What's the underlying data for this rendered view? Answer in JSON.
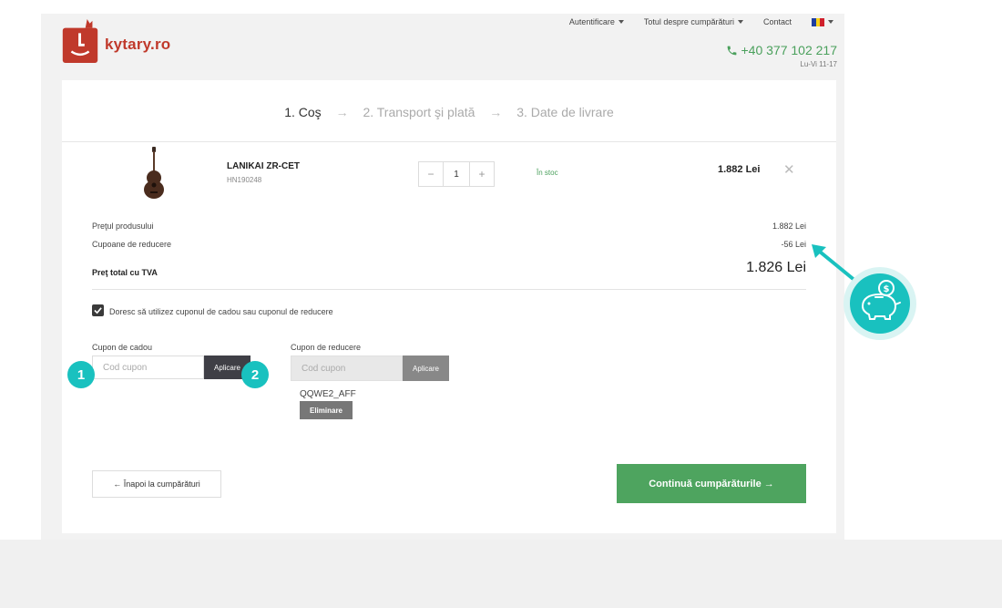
{
  "brand": {
    "name": "kytary.ro",
    "color": "#c0392b"
  },
  "topnav": {
    "login": "Autentificare",
    "shopping_info": "Totul despre cumpărături",
    "contact": "Contact",
    "language": "Română"
  },
  "contact": {
    "phone": "+40 377 102 217",
    "hours": "Lu-Vi 11-17"
  },
  "steps": [
    {
      "label": "1. Coş",
      "active": true
    },
    {
      "label": "2. Transport şi plată",
      "active": false
    },
    {
      "label": "3. Date de livrare",
      "active": false
    }
  ],
  "step_arrow": "→",
  "product": {
    "name": "LANIKAI ZR-CET",
    "code": "HN190248",
    "quantity": "1",
    "qty_minus": "−",
    "qty_plus": "+",
    "stock": "În stoc",
    "price": "1.882 Lei",
    "remove": "✕"
  },
  "summary": {
    "product_price_label": "Preţul produsului",
    "product_price_value": "1.882 Lei",
    "coupons_label": "Cupoane de reducere",
    "coupons_value": "-56 Lei",
    "total_label": "Preţ total cu TVA",
    "total_value": "1.826 Lei"
  },
  "coupon": {
    "checkbox_label": "Doresc să utilizez cuponul de cadou sau cuponul de reducere",
    "checked": true,
    "gift_label": "Cupon de cadou",
    "gift_placeholder": "Cod cupon",
    "gift_apply": "Aplicare",
    "discount_label": "Cupon de reducere",
    "discount_placeholder": "Cod cupon",
    "discount_apply": "Aplicare",
    "applied_code": "QQWE2_AFF",
    "remove_label": "Eliminare"
  },
  "actions": {
    "back": "← Înapoi la cumpărături",
    "continue": "Continuă cumpărăturile →"
  },
  "annotations": {
    "badge_1": "1",
    "badge_2": "2"
  },
  "colors": {
    "accent_green": "#4ea45f",
    "teal": "#19c1bf",
    "brand_red": "#c0392b"
  }
}
